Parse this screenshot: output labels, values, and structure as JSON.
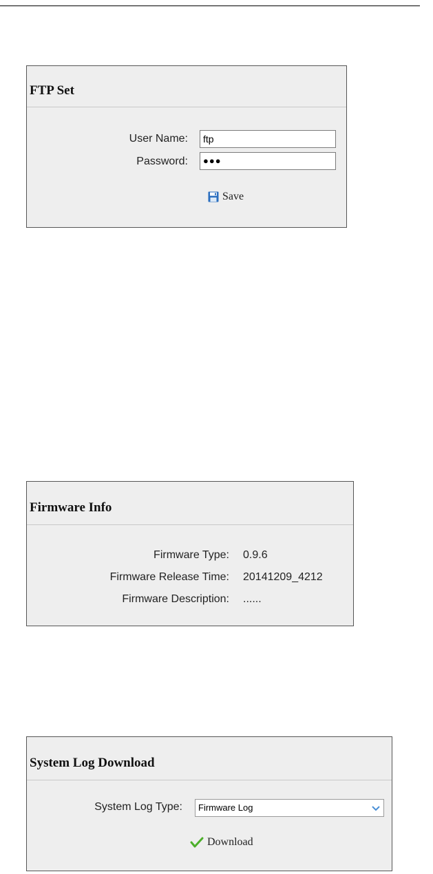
{
  "ftp": {
    "title": "FTP Set",
    "username_label": "User Name:",
    "username_value": "ftp",
    "password_label": "Password:",
    "password_mask": "●●●",
    "save_label": "Save"
  },
  "firmware": {
    "title": "Firmware Info",
    "rows": [
      {
        "label": "Firmware Type:",
        "value": "0.9.6"
      },
      {
        "label": "Firmware Release Time:",
        "value": "20141209_4212"
      },
      {
        "label": "Firmware Description:",
        "value": "......"
      }
    ]
  },
  "syslog": {
    "title": "System Log Download",
    "type_label": "System Log Type:",
    "type_selected": "Firmware Log",
    "download_label": "Download"
  },
  "icons": {
    "save": "floppy-disk-icon",
    "download": "checkmark-icon",
    "dropdown": "chevron-down-icon"
  },
  "colors": {
    "panel_bg": "#eeeeee",
    "save_icon": "#2a6ebf",
    "check_icon": "#4caf2a"
  }
}
